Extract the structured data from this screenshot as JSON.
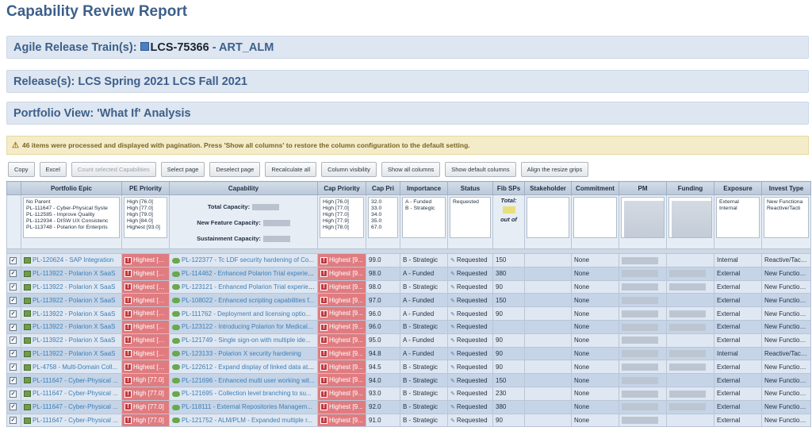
{
  "header": {
    "report_title": "Capability Review Report",
    "art_label": "Agile Release Train(s):",
    "art_id": "LCS-75366",
    "art_name": "- ART_ALM",
    "release_label": "Release(s): LCS Spring 2021 LCS Fall 2021",
    "portfolio_view": "Portfolio View: 'What If' Analysis"
  },
  "warning": "46 items were processed and displayed with pagination. Press 'Show all columns' to restore the column configuration to the default setting.",
  "toolbar": {
    "copy": "Copy",
    "excel": "Excel",
    "count_selected": "Count selected Capabilities",
    "select_page": "Select page",
    "deselect_page": "Deselect page",
    "recalculate_all": "Recalculate all",
    "column_visibility": "Column visibility",
    "show_all_columns": "Show all columns",
    "show_default_columns": "Show default columns",
    "align_resize_grips": "Align the resize grips"
  },
  "columns": [
    "Portfolio Epic",
    "PE Priority",
    "Capability",
    "Cap Priority",
    "Cap Pri",
    "Importance",
    "Status",
    "Fib SPs",
    "Stakeholder",
    "Commitment",
    "PM",
    "Funding",
    "Exposure",
    "Invest Type"
  ],
  "summary": {
    "epic_lines": [
      "No Parent",
      "PL-111647 - Cyber-Physical Syste",
      "PL-112585 - Improve Quality",
      "PL-112934 - DISW UX Consistenc",
      "PL-113748 - Polarion for Enterpris"
    ],
    "pe_priority_lines": [
      "High [76.0]",
      "High [77.0]",
      "High [79.0]",
      "High [84.0]",
      "Highest [93.0]"
    ],
    "total_capacity": "Total Capacity:",
    "new_feature_capacity": "New Feature Capacity:",
    "sustainment_capacity": "Sustainment Capacity:",
    "cap_priority_lines": [
      "High [76.0]",
      "High [77.0]",
      "High [77.0]",
      "High [77.9]",
      "High [78.0]"
    ],
    "cap_pri_lines": [
      "32.0",
      "33.0",
      "34.0",
      "35.0",
      "67.0"
    ],
    "importance_lines": [
      "A - Funded",
      "B - Strategic"
    ],
    "status_lines": [
      "Requested"
    ],
    "fib_total": "Total:",
    "fib_out_of": "out of",
    "exposure_lines": [
      "External",
      "Internal"
    ],
    "invest_lines": [
      "New Functiona",
      "Reactive/Tacti"
    ]
  },
  "rows": [
    {
      "epic": "PL-120624 - SAP Integration",
      "pe_priority": "Highest [9...",
      "capability": "PL-122377 - Tc LDF security hardening of Co...",
      "cap_priority": "Highest [9...",
      "cap_pri": "99.0",
      "importance": "B - Strategic",
      "status": "Requested",
      "fib": "150",
      "commitment": "None",
      "exposure": "Internal",
      "invest": "Reactive/Tacti..."
    },
    {
      "epic": "PL-113922 - Polarion X SaaS",
      "pe_priority": "Highest [9...",
      "capability": "PL-114462 - Enhanced Polarion Trial experien...",
      "cap_priority": "Highest [9...",
      "cap_pri": "98.0",
      "importance": "A - Funded",
      "status": "Requested",
      "fib": "380",
      "commitment": "None",
      "exposure": "External",
      "invest": "New Function..."
    },
    {
      "epic": "PL-113922 - Polarion X SaaS",
      "pe_priority": "Highest [9...",
      "capability": "PL-123121 - Enhanced Polarion Trial experien...",
      "cap_priority": "Highest [9...",
      "cap_pri": "98.0",
      "importance": "B - Strategic",
      "status": "Requested",
      "fib": "90",
      "commitment": "None",
      "exposure": "External",
      "invest": "New Function..."
    },
    {
      "epic": "PL-113922 - Polarion X SaaS",
      "pe_priority": "Highest [9...",
      "capability": "PL-108022 - Enhanced scripting capabilities f...",
      "cap_priority": "Highest [9...",
      "cap_pri": "97.0",
      "importance": "A - Funded",
      "status": "Requested",
      "fib": "150",
      "commitment": "None",
      "exposure": "External",
      "invest": "New Function..."
    },
    {
      "epic": "PL-113922 - Polarion X SaaS",
      "pe_priority": "Highest [9...",
      "capability": "PL-111762 - Deployment and licensing optio...",
      "cap_priority": "Highest [9...",
      "cap_pri": "96.0",
      "importance": "A - Funded",
      "status": "Requested",
      "fib": "90",
      "commitment": "None",
      "exposure": "External",
      "invest": "New Function..."
    },
    {
      "epic": "PL-113922 - Polarion X SaaS",
      "pe_priority": "Highest [9...",
      "capability": "PL-123122 - Introducing Polarion for Medical...",
      "cap_priority": "Highest [9...",
      "cap_pri": "96.0",
      "importance": "B - Strategic",
      "status": "Requested",
      "fib": "",
      "commitment": "None",
      "exposure": "External",
      "invest": "New Function..."
    },
    {
      "epic": "PL-113922 - Polarion X SaaS",
      "pe_priority": "Highest [9...",
      "capability": "PL-121749 - Single sign-on with multiple ide...",
      "cap_priority": "Highest [9...",
      "cap_pri": "95.0",
      "importance": "A - Funded",
      "status": "Requested",
      "fib": "90",
      "commitment": "None",
      "exposure": "External",
      "invest": "New Function..."
    },
    {
      "epic": "PL-113922 - Polarion X SaaS",
      "pe_priority": "Highest [9...",
      "capability": "PL-123133 - Polarion X security hardening",
      "cap_priority": "Highest [9...",
      "cap_pri": "94.8",
      "importance": "A - Funded",
      "status": "Requested",
      "fib": "90",
      "commitment": "None",
      "exposure": "Internal",
      "invest": "Reactive/Tacti..."
    },
    {
      "epic": "PL-4758 - Multi-Domain Coll...",
      "pe_priority": "Highest [9...",
      "capability": "PL-122612 - Expand display of linked data att...",
      "cap_priority": "Highest [9...",
      "cap_pri": "94.5",
      "importance": "B - Strategic",
      "status": "Requested",
      "fib": "90",
      "commitment": "None",
      "exposure": "External",
      "invest": "New Function..."
    },
    {
      "epic": "PL-111647 - Cyber-Physical ...",
      "pe_priority": "High [77.0]",
      "capability": "PL-121696 - Enhanced multi user working wit...",
      "cap_priority": "Highest [9...",
      "cap_pri": "94.0",
      "importance": "B - Strategic",
      "status": "Requested",
      "fib": "150",
      "commitment": "None",
      "exposure": "External",
      "invest": "New Function..."
    },
    {
      "epic": "PL-111647 - Cyber-Physical ...",
      "pe_priority": "High [77.0]",
      "capability": "PL-121695 - Collection level branching to su...",
      "cap_priority": "Highest [9...",
      "cap_pri": "93.0",
      "importance": "B - Strategic",
      "status": "Requested",
      "fib": "230",
      "commitment": "None",
      "exposure": "External",
      "invest": "New Function..."
    },
    {
      "epic": "PL-111647 - Cyber-Physical ...",
      "pe_priority": "High [77.0]",
      "capability": "PL-118111 - External Repositories Managem...",
      "cap_priority": "Highest [9...",
      "cap_pri": "92.0",
      "importance": "B - Strategic",
      "status": "Requested",
      "fib": "380",
      "commitment": "None",
      "exposure": "External",
      "invest": "New Function..."
    },
    {
      "epic": "PL-111647 - Cyber-Physical ...",
      "pe_priority": "High [77.0]",
      "capability": "PL-121752 - ALM/PLM - Expanded multiple r...",
      "cap_priority": "Highest [9...",
      "cap_pri": "91.0",
      "importance": "B - Strategic",
      "status": "Requested",
      "fib": "90",
      "commitment": "None",
      "exposure": "External",
      "invest": "New Function..."
    }
  ],
  "colors": {
    "accent": "#3d5f8a",
    "priority": "#e07c80",
    "link": "#3d7fb6",
    "row_even": "#c5d4e7",
    "row_odd": "#dfe7f2"
  }
}
